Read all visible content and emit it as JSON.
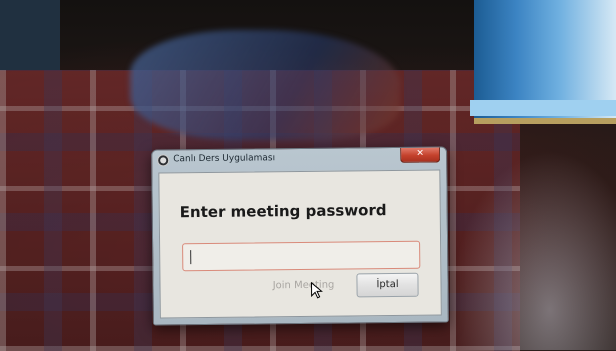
{
  "dialog": {
    "title": "Canlı Ders Uygulaması",
    "close_label": "✕",
    "heading": "Enter meeting password",
    "password": {
      "value": "",
      "placeholder": ""
    },
    "join_label": "Join Meeting",
    "cancel_label": "İptal"
  },
  "icons": {
    "app": "app-logo-icon",
    "close": "close-icon",
    "cursor": "mouse-pointer-icon"
  },
  "colors": {
    "close_button": "#c4412c",
    "input_border": "#d98a7a",
    "disabled_text": "#a9a6a2"
  }
}
